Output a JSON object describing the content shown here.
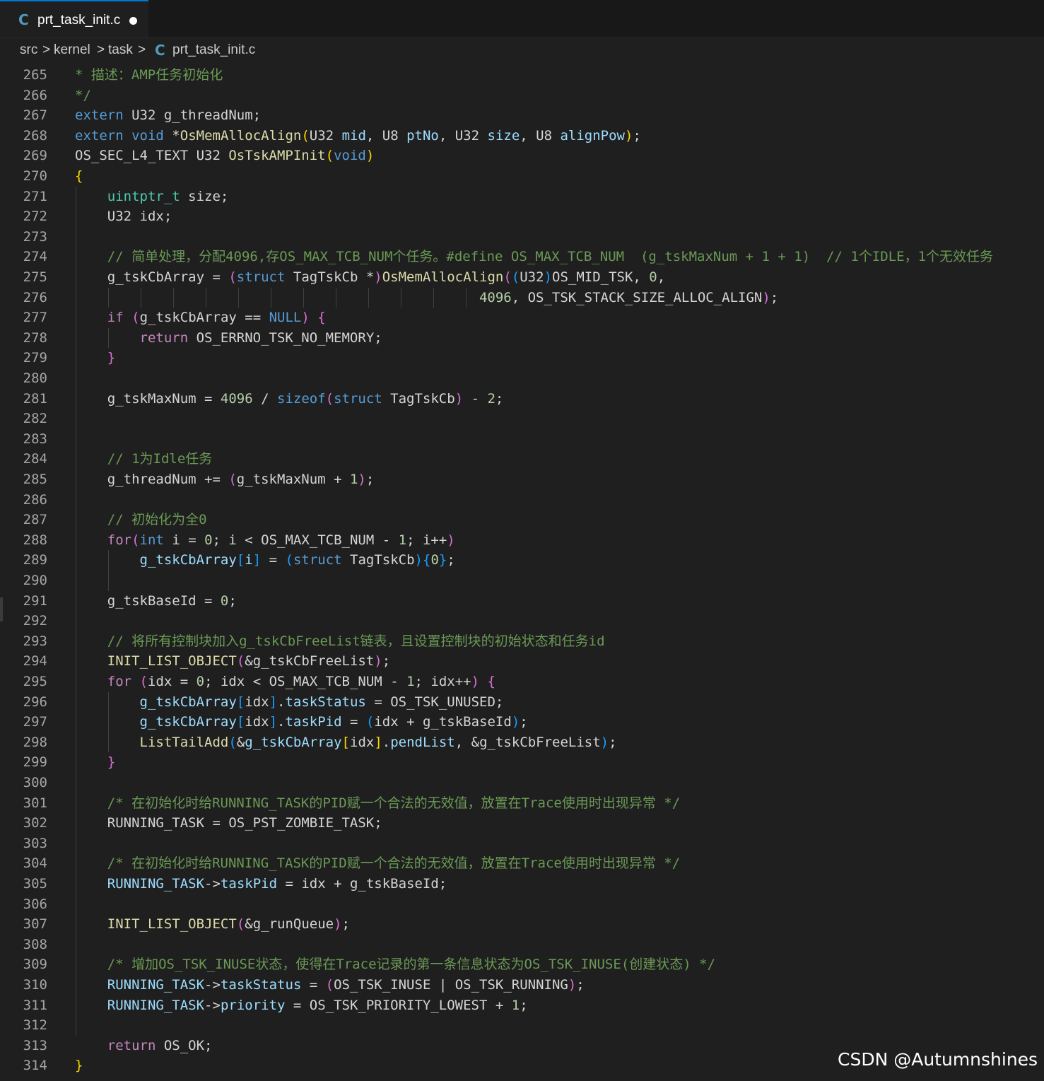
{
  "tab": {
    "icon": "c-file-icon",
    "title": "prt_task_init.c",
    "modified": true
  },
  "breadcrumb": {
    "parts": [
      "src",
      "kernel",
      "task",
      "prt_task_init.c"
    ],
    "separator": ">"
  },
  "editor": {
    "first_line": 265,
    "lines": [
      [
        [
          "m",
          "* 描述：AMP任务初始化"
        ]
      ],
      [
        [
          "m",
          "*/"
        ]
      ],
      [
        [
          "k",
          "extern"
        ],
        [
          "w",
          " U32 g_threadNum;"
        ]
      ],
      [
        [
          "k",
          "extern"
        ],
        [
          "w",
          " "
        ],
        [
          "k",
          "void"
        ],
        [
          "w",
          " *"
        ],
        [
          "f",
          "OsMemAllocAlign"
        ],
        [
          "p",
          "("
        ],
        [
          "w",
          "U32 "
        ],
        [
          "v",
          "mid"
        ],
        [
          "w",
          ", U8 "
        ],
        [
          "v",
          "ptNo"
        ],
        [
          "w",
          ", U32 "
        ],
        [
          "v",
          "size"
        ],
        [
          "w",
          ", U8 "
        ],
        [
          "v",
          "alignPow"
        ],
        [
          "p",
          ")"
        ],
        [
          "w",
          ";"
        ]
      ],
      [
        [
          "w",
          "OS_SEC_L4_TEXT U32 "
        ],
        [
          "f",
          "OsTskAMPInit"
        ],
        [
          "p",
          "("
        ],
        [
          "k",
          "void"
        ],
        [
          "p",
          ")"
        ]
      ],
      [
        [
          "p",
          "{"
        ]
      ],
      [
        [
          "w",
          "    "
        ],
        [
          "t",
          "uintptr_t"
        ],
        [
          "w",
          " size;"
        ]
      ],
      [
        [
          "w",
          "    U32 idx;"
        ]
      ],
      [],
      [
        [
          "w",
          "    "
        ],
        [
          "m",
          "// 简单处理，分配4096,存OS_MAX_TCB_NUM个任务。#define OS_MAX_TCB_NUM  (g_tskMaxNum + 1 + 1)  // 1个IDLE，1个无效任务"
        ]
      ],
      [
        [
          "w",
          "    g_tskCbArray = "
        ],
        [
          "pp",
          "("
        ],
        [
          "k",
          "struct"
        ],
        [
          "w",
          " TagTskCb *"
        ],
        [
          "pp",
          ")"
        ],
        [
          "f",
          "OsMemAllocAlign"
        ],
        [
          "pp",
          "("
        ],
        [
          "pb",
          "("
        ],
        [
          "w",
          "U32"
        ],
        [
          "pb",
          ")"
        ],
        [
          "w",
          "OS_MID_TSK, "
        ],
        [
          "n",
          "0"
        ],
        [
          "w",
          ","
        ]
      ],
      [
        [
          "w",
          "                                                  "
        ],
        [
          "n",
          "4096"
        ],
        [
          "w",
          ", OS_TSK_STACK_SIZE_ALLOC_ALIGN"
        ],
        [
          "pp",
          ")"
        ],
        [
          "w",
          ";"
        ]
      ],
      [
        [
          "w",
          "    "
        ],
        [
          "c",
          "if"
        ],
        [
          "w",
          " "
        ],
        [
          "pp",
          "("
        ],
        [
          "w",
          "g_tskCbArray == "
        ],
        [
          "mac",
          "NULL"
        ],
        [
          "pp",
          ")"
        ],
        [
          "w",
          " "
        ],
        [
          "pp",
          "{"
        ]
      ],
      [
        [
          "w",
          "        "
        ],
        [
          "c",
          "return"
        ],
        [
          "w",
          " OS_ERRNO_TSK_NO_MEMORY;"
        ]
      ],
      [
        [
          "w",
          "    "
        ],
        [
          "pp",
          "}"
        ]
      ],
      [],
      [
        [
          "w",
          "    g_tskMaxNum = "
        ],
        [
          "n",
          "4096"
        ],
        [
          "w",
          " / "
        ],
        [
          "k",
          "sizeof"
        ],
        [
          "pp",
          "("
        ],
        [
          "k",
          "struct"
        ],
        [
          "w",
          " TagTskCb"
        ],
        [
          "pp",
          ")"
        ],
        [
          "w",
          " - "
        ],
        [
          "n",
          "2"
        ],
        [
          "w",
          ";"
        ]
      ],
      [],
      [],
      [
        [
          "w",
          "    "
        ],
        [
          "m",
          "// 1为Idle任务"
        ]
      ],
      [
        [
          "w",
          "    g_threadNum += "
        ],
        [
          "pp",
          "("
        ],
        [
          "w",
          "g_tskMaxNum + "
        ],
        [
          "n",
          "1"
        ],
        [
          "pp",
          ")"
        ],
        [
          "w",
          ";"
        ]
      ],
      [],
      [
        [
          "w",
          "    "
        ],
        [
          "m",
          "// 初始化为全0"
        ]
      ],
      [
        [
          "w",
          "    "
        ],
        [
          "c",
          "for"
        ],
        [
          "pp",
          "("
        ],
        [
          "k",
          "int"
        ],
        [
          "w",
          " i = "
        ],
        [
          "n",
          "0"
        ],
        [
          "w",
          "; i < OS_MAX_TCB_NUM - "
        ],
        [
          "n",
          "1"
        ],
        [
          "w",
          "; i++"
        ],
        [
          "pp",
          ")"
        ]
      ],
      [
        [
          "w",
          "        "
        ],
        [
          "v",
          "g_tskCbArray"
        ],
        [
          "pb",
          "["
        ],
        [
          "v",
          "i"
        ],
        [
          "pb",
          "]"
        ],
        [
          "w",
          " = "
        ],
        [
          "pb",
          "("
        ],
        [
          "k",
          "struct"
        ],
        [
          "w",
          " TagTskCb"
        ],
        [
          "pb",
          ")"
        ],
        [
          "pb",
          "{"
        ],
        [
          "n",
          "0"
        ],
        [
          "pb",
          "}"
        ],
        [
          "w",
          ";"
        ]
      ],
      [],
      [
        [
          "w",
          "    g_tskBaseId = "
        ],
        [
          "n",
          "0"
        ],
        [
          "w",
          ";"
        ]
      ],
      [],
      [
        [
          "w",
          "    "
        ],
        [
          "m",
          "// 将所有控制块加入g_tskCbFreeList链表，且设置控制块的初始状态和任务id"
        ]
      ],
      [
        [
          "w",
          "    "
        ],
        [
          "f",
          "INIT_LIST_OBJECT"
        ],
        [
          "pp",
          "("
        ],
        [
          "w",
          "&g_tskCbFreeList"
        ],
        [
          "pp",
          ")"
        ],
        [
          "w",
          ";"
        ]
      ],
      [
        [
          "w",
          "    "
        ],
        [
          "c",
          "for"
        ],
        [
          "w",
          " "
        ],
        [
          "pp",
          "("
        ],
        [
          "w",
          "idx = "
        ],
        [
          "n",
          "0"
        ],
        [
          "w",
          "; idx < OS_MAX_TCB_NUM - "
        ],
        [
          "n",
          "1"
        ],
        [
          "w",
          "; idx++"
        ],
        [
          "pp",
          ")"
        ],
        [
          "w",
          " "
        ],
        [
          "pp",
          "{"
        ]
      ],
      [
        [
          "w",
          "        "
        ],
        [
          "v",
          "g_tskCbArray"
        ],
        [
          "pb",
          "["
        ],
        [
          "w",
          "idx"
        ],
        [
          "pb",
          "]"
        ],
        [
          "w",
          "."
        ],
        [
          "v",
          "taskStatus"
        ],
        [
          "w",
          " = OS_TSK_UNUSED;"
        ]
      ],
      [
        [
          "w",
          "        "
        ],
        [
          "v",
          "g_tskCbArray"
        ],
        [
          "pb",
          "["
        ],
        [
          "w",
          "idx"
        ],
        [
          "pb",
          "]"
        ],
        [
          "w",
          "."
        ],
        [
          "v",
          "taskPid"
        ],
        [
          "w",
          " = "
        ],
        [
          "pb",
          "("
        ],
        [
          "w",
          "idx + g_tskBaseId"
        ],
        [
          "pb",
          ")"
        ],
        [
          "w",
          ";"
        ]
      ],
      [
        [
          "w",
          "        "
        ],
        [
          "f",
          "ListTailAdd"
        ],
        [
          "pb",
          "("
        ],
        [
          "w",
          "&"
        ],
        [
          "v",
          "g_tskCbArray"
        ],
        [
          "p",
          "["
        ],
        [
          "w",
          "idx"
        ],
        [
          "p",
          "]"
        ],
        [
          "w",
          "."
        ],
        [
          "v",
          "pendList"
        ],
        [
          "w",
          ", &g_tskCbFreeList"
        ],
        [
          "pb",
          ")"
        ],
        [
          "w",
          ";"
        ]
      ],
      [
        [
          "w",
          "    "
        ],
        [
          "pp",
          "}"
        ]
      ],
      [],
      [
        [
          "w",
          "    "
        ],
        [
          "m",
          "/* 在初始化时给RUNNING_TASK的PID赋一个合法的无效值，放置在Trace使用时出现异常 */"
        ]
      ],
      [
        [
          "w",
          "    RUNNING_TASK = OS_PST_ZOMBIE_TASK;"
        ]
      ],
      [],
      [
        [
          "w",
          "    "
        ],
        [
          "m",
          "/* 在初始化时给RUNNING_TASK的PID赋一个合法的无效值，放置在Trace使用时出现异常 */"
        ]
      ],
      [
        [
          "w",
          "    "
        ],
        [
          "v",
          "RUNNING_TASK"
        ],
        [
          "w",
          "->"
        ],
        [
          "v",
          "taskPid"
        ],
        [
          "w",
          " = idx + g_tskBaseId;"
        ]
      ],
      [],
      [
        [
          "w",
          "    "
        ],
        [
          "f",
          "INIT_LIST_OBJECT"
        ],
        [
          "pp",
          "("
        ],
        [
          "w",
          "&g_runQueue"
        ],
        [
          "pp",
          ")"
        ],
        [
          "w",
          ";"
        ]
      ],
      [],
      [
        [
          "w",
          "    "
        ],
        [
          "m",
          "/* 增加OS_TSK_INUSE状态，使得在Trace记录的第一条信息状态为OS_TSK_INUSE(创建状态) */"
        ]
      ],
      [
        [
          "w",
          "    "
        ],
        [
          "v",
          "RUNNING_TASK"
        ],
        [
          "w",
          "->"
        ],
        [
          "v",
          "taskStatus"
        ],
        [
          "w",
          " = "
        ],
        [
          "pp",
          "("
        ],
        [
          "w",
          "OS_TSK_INUSE | OS_TSK_RUNNING"
        ],
        [
          "pp",
          ")"
        ],
        [
          "w",
          ";"
        ]
      ],
      [
        [
          "w",
          "    "
        ],
        [
          "v",
          "RUNNING_TASK"
        ],
        [
          "w",
          "->"
        ],
        [
          "v",
          "priority"
        ],
        [
          "w",
          " = OS_TSK_PRIORITY_LOWEST + "
        ],
        [
          "n",
          "1"
        ],
        [
          "w",
          ";"
        ]
      ],
      [],
      [
        [
          "w",
          "    "
        ],
        [
          "c",
          "return"
        ],
        [
          "w",
          " OS_OK;"
        ]
      ],
      [
        [
          "p",
          "}"
        ]
      ]
    ]
  },
  "watermark": "CSDN @Autumnshines"
}
